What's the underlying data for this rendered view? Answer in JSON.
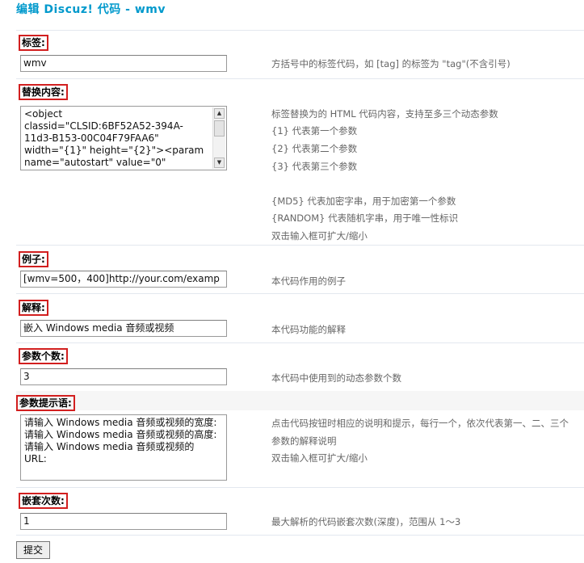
{
  "page": {
    "title": "编辑 Discuz! 代码 - wmv"
  },
  "fields": {
    "tag": {
      "label": "标签:",
      "value": "wmv",
      "desc": "方括号中的标签代码，如 [tag] 的标签为 \"tag\"(不含引号)"
    },
    "replacement": {
      "label": "替换内容:",
      "lines": [
        "<object",
        "classid=\"CLSID:6BF52A52-394A-",
        "11d3-B153-00C04F79FAA6\"",
        "width=\"{1}\" height=\"{2}\"><param",
        "name=\"autostart\" value=\"0\""
      ],
      "desc": [
        "标签替换为的 HTML 代码内容，支持至多三个动态参数",
        "{1} 代表第一个参数",
        "{2} 代表第二个参数",
        "{3} 代表第三个参数",
        "",
        "{MD5} 代表加密字串，用于加密第一个参数",
        "{RANDOM} 代表随机字串，用于唯一性标识",
        "双击输入框可扩大/缩小"
      ]
    },
    "example": {
      "label": "例子:",
      "value": "[wmv=500，400]http://your.com/examp",
      "desc": "本代码作用的例子"
    },
    "explanation": {
      "label": "解释:",
      "value": "嵌入 Windows media 音频或视频",
      "desc": "本代码功能的解释"
    },
    "param_count": {
      "label": "参数个数:",
      "value": "3",
      "desc": "本代码中使用到的动态参数个数"
    },
    "param_prompt": {
      "label": "参数提示语:",
      "lines": [
        "请输入 Windows media 音频或视频的宽度:",
        "请输入 Windows media 音频或视频的高度:",
        "请输入 Windows media 音频或视频的",
        "URL:"
      ],
      "desc": [
        "点击代码按钮时相应的说明和提示，每行一个，依次代表第一、二、三个",
        "参数的解释说明",
        "双击输入框可扩大/缩小"
      ]
    },
    "nesting": {
      "label": "嵌套次数:",
      "value": "1",
      "desc": "最大解析的代码嵌套次数(深度)，范围从 1～3"
    }
  },
  "submit": {
    "label": "提交"
  },
  "icons": {
    "scroll_up": "scroll-up-arrow",
    "scroll_down": "scroll-down-arrow"
  },
  "colors": {
    "title": "#0099cc",
    "highlight": "#d21f1f",
    "desc": "#666666"
  }
}
